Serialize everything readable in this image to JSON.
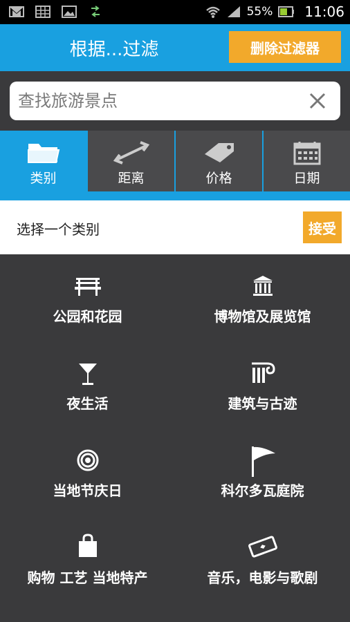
{
  "status_bar": {
    "battery": "55%",
    "time": "11:06"
  },
  "header": {
    "title": "根据...过滤",
    "clear_filter": "删除过滤器"
  },
  "search": {
    "placeholder": "查找旅游景点"
  },
  "tabs": [
    {
      "label": "类别",
      "icon": "folder-icon",
      "active": true
    },
    {
      "label": "距离",
      "icon": "distance-arrow-icon",
      "active": false
    },
    {
      "label": "价格",
      "icon": "price-tag-icon",
      "active": false
    },
    {
      "label": "日期",
      "icon": "calendar-icon",
      "active": false
    }
  ],
  "category_bar": {
    "label": "选择一个类别",
    "accept": "接受"
  },
  "categories": [
    {
      "label": "公园和花园",
      "icon": "bench-icon"
    },
    {
      "label": "博物馆及展览馆",
      "icon": "museum-icon"
    },
    {
      "label": "夜生活",
      "icon": "cocktail-icon"
    },
    {
      "label": "建筑与古迹",
      "icon": "column-icon"
    },
    {
      "label": "当地节庆日",
      "icon": "target-icon"
    },
    {
      "label": "科尔多瓦庭院",
      "icon": "flag-icon"
    },
    {
      "label": "购物 工艺 当地特产",
      "icon": "shopping-bag-icon"
    },
    {
      "label": "音乐，电影与歌剧",
      "icon": "ticket-icon"
    }
  ],
  "colors": {
    "accent_blue": "#19a0e0",
    "button_orange": "#f2a92b",
    "background_dark": "#3a3a3c"
  }
}
